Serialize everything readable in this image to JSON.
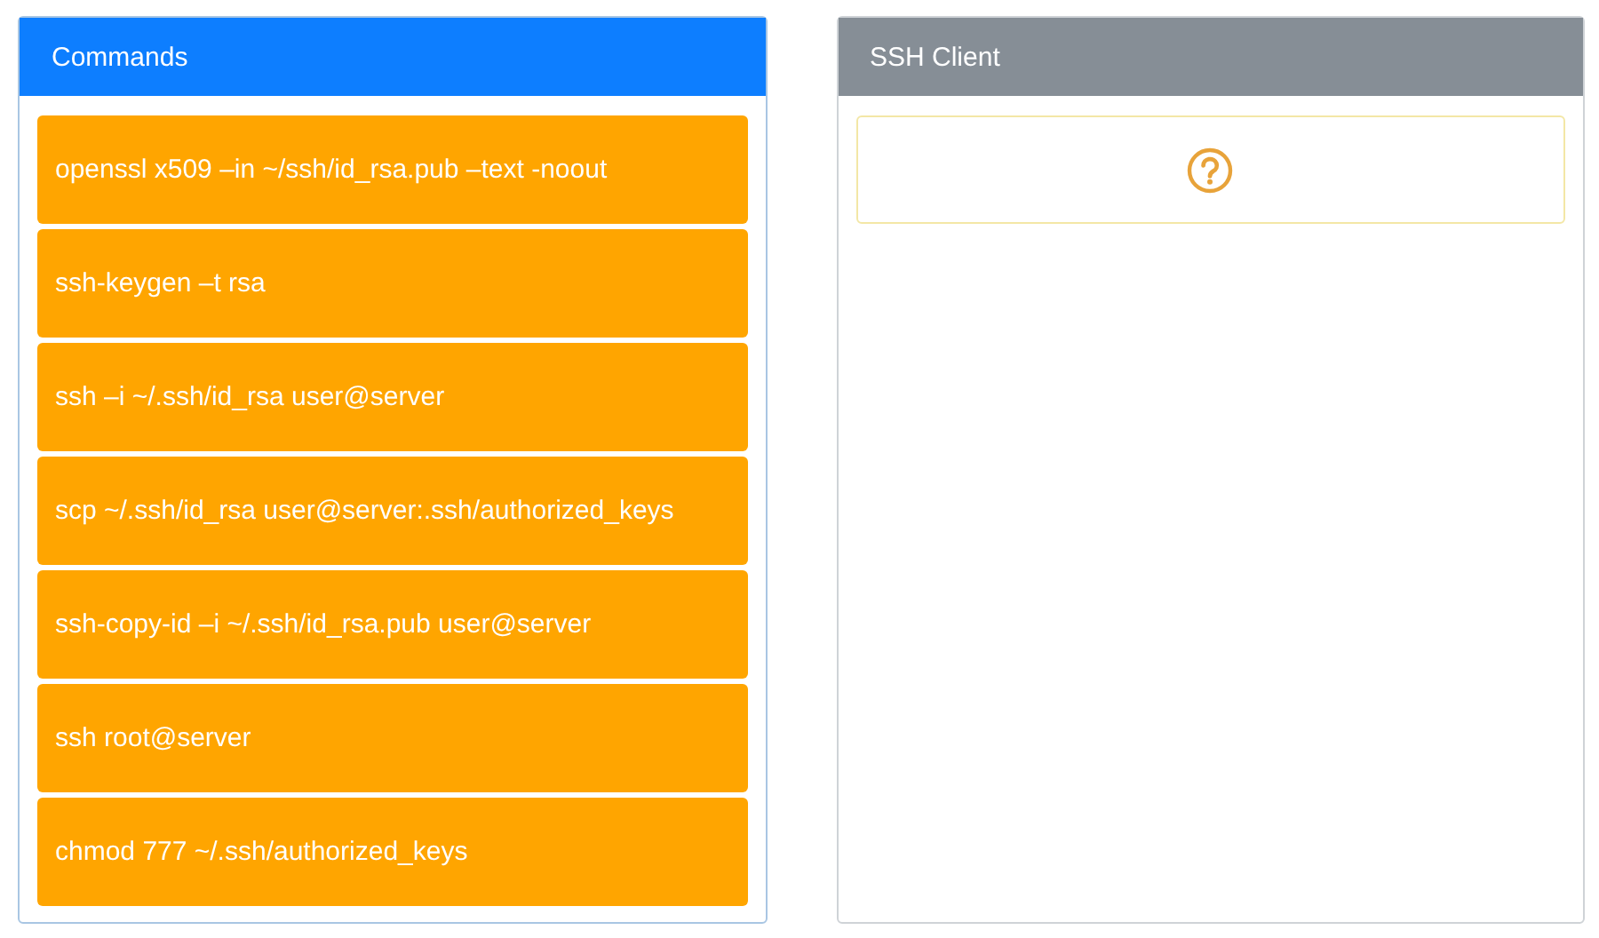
{
  "commands_panel": {
    "title": "Commands",
    "items": [
      {
        "label": "openssl x509 –in ~/ssh/id_rsa.pub –text -noout"
      },
      {
        "label": "ssh-keygen –t rsa"
      },
      {
        "label": "ssh –i ~/.ssh/id_rsa user@server"
      },
      {
        "label": "scp ~/.ssh/id_rsa user@server:.ssh/authorized_keys"
      },
      {
        "label": "ssh-copy-id –i ~/.ssh/id_rsa.pub user@server"
      },
      {
        "label": "ssh root@server"
      },
      {
        "label": "chmod 777 ~/.ssh/authorized_keys"
      }
    ]
  },
  "client_panel": {
    "title": "SSH Client",
    "slots": [
      {
        "kind": "empty"
      }
    ]
  }
}
